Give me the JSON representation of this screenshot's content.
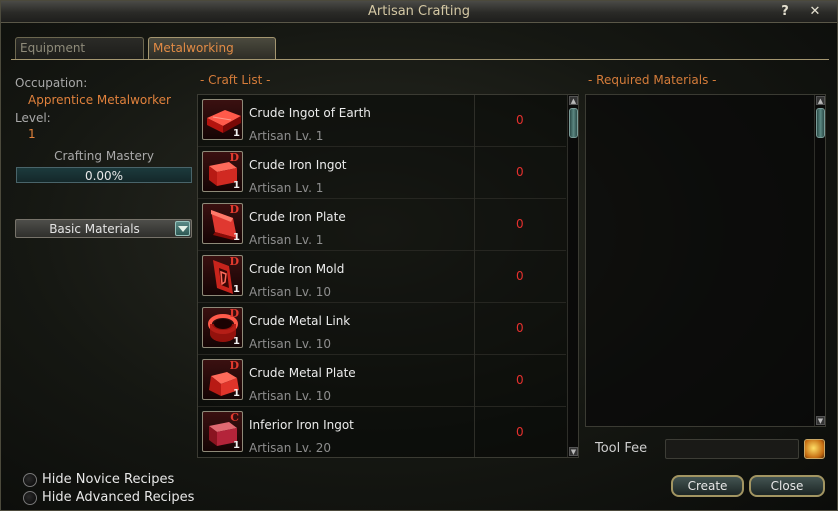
{
  "window": {
    "title": "Artisan Crafting"
  },
  "tabs": [
    {
      "label": "Equipment",
      "active": false
    },
    {
      "label": "Metalworking",
      "active": true
    }
  ],
  "sidebar": {
    "occupation_label": "Occupation:",
    "occupation_value": "Apprentice Metalworker",
    "level_label": "Level:",
    "level_value": "1",
    "mastery_label": "Crafting Mastery",
    "mastery_value": "0.00%",
    "mastery_progress": 0.0,
    "category_selected": "Basic Materials"
  },
  "craft_list": {
    "title": "- Craft List -",
    "items": [
      {
        "name": "Crude Ingot of Earth",
        "level": "Artisan Lv. 1",
        "count": "0",
        "grade": "",
        "qty": "1",
        "icon": "ingot-icon"
      },
      {
        "name": "Crude Iron Ingot",
        "level": "Artisan Lv. 1",
        "count": "0",
        "grade": "D",
        "qty": "1",
        "icon": "iron-ingot-icon"
      },
      {
        "name": "Crude Iron Plate",
        "level": "Artisan Lv. 1",
        "count": "0",
        "grade": "D",
        "qty": "1",
        "icon": "iron-plate-icon"
      },
      {
        "name": "Crude Iron Mold",
        "level": "Artisan Lv. 10",
        "count": "0",
        "grade": "D",
        "qty": "1",
        "icon": "iron-mold-icon"
      },
      {
        "name": "Crude Metal Link",
        "level": "Artisan Lv. 10",
        "count": "0",
        "grade": "D",
        "qty": "1",
        "icon": "metal-link-icon"
      },
      {
        "name": "Crude Metal Plate",
        "level": "Artisan Lv. 10",
        "count": "0",
        "grade": "D",
        "qty": "1",
        "icon": "metal-plate-icon"
      },
      {
        "name": "Inferior Iron Ingot",
        "level": "Artisan Lv. 20",
        "count": "0",
        "grade": "C",
        "qty": "1",
        "icon": "iron-ingot-icon"
      }
    ]
  },
  "materials": {
    "title": "- Required Materials -"
  },
  "tool_fee": {
    "label": "Tool Fee",
    "value": ""
  },
  "options": [
    {
      "label": "Hide Novice Recipes"
    },
    {
      "label": "Hide Advanced Recipes"
    }
  ],
  "buttons": {
    "create": "Create",
    "close": "Close"
  },
  "colors": {
    "accent": "#e0813c",
    "count_red": "#e5302e",
    "border_gold": "#a29562"
  }
}
